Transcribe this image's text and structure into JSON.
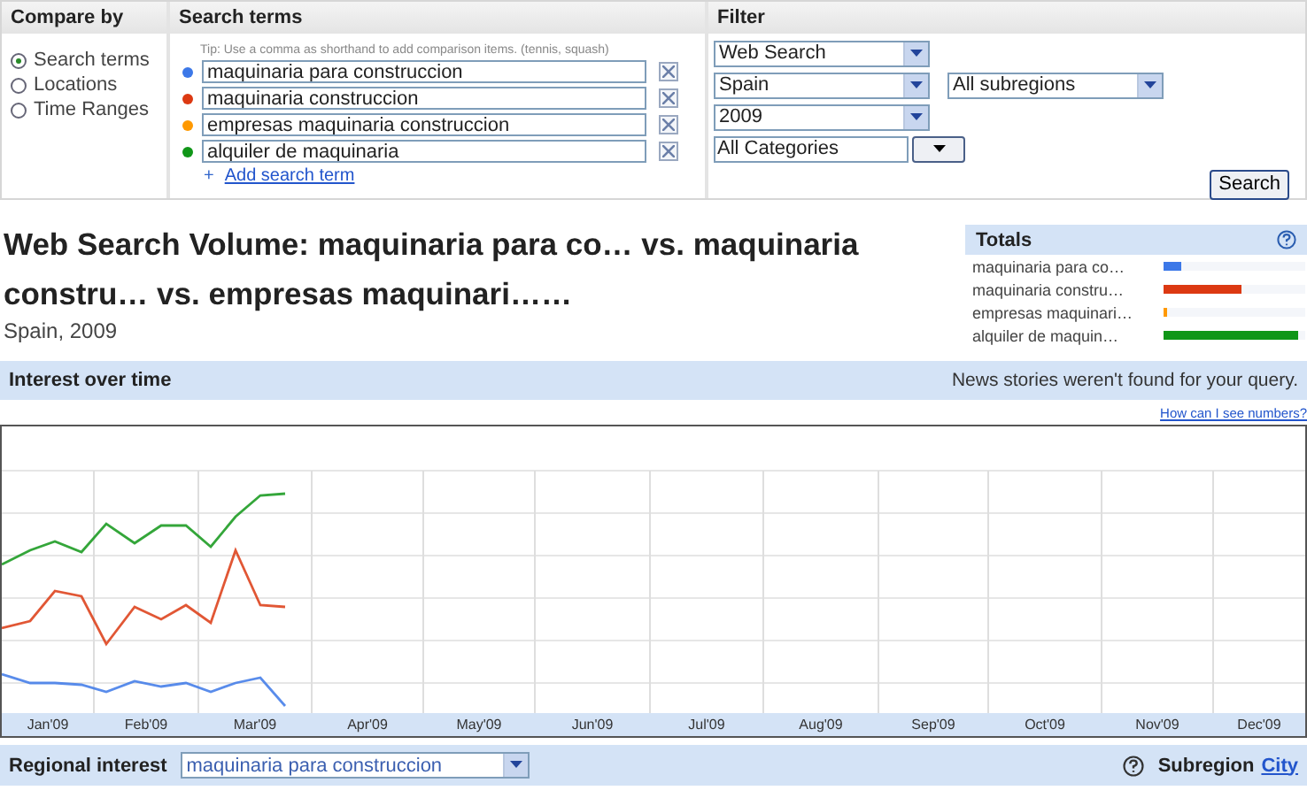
{
  "compare_by": {
    "title": "Compare by",
    "options": [
      {
        "label": "Search terms",
        "selected": true
      },
      {
        "label": "Locations",
        "selected": false
      },
      {
        "label": "Time Ranges",
        "selected": false
      }
    ]
  },
  "search_terms": {
    "title": "Search terms",
    "tip": "Tip: Use a comma as shorthand to add comparison items. (tennis, squash)",
    "terms": [
      {
        "value": "maquinaria para construccion",
        "color": "#3c78e8"
      },
      {
        "value": "maquinaria construccion",
        "color": "#dc3912"
      },
      {
        "value": "empresas maquinaria construccion",
        "color": "#ff9900"
      },
      {
        "value": "alquiler de maquinaria",
        "color": "#109618"
      }
    ],
    "add_icon": "+",
    "add_link": "Add search term"
  },
  "filter": {
    "title": "Filter",
    "property": "Web Search",
    "location": "Spain",
    "subregion": "All subregions",
    "time": "2009",
    "category": "All Categories",
    "search_button": "Search"
  },
  "heading": {
    "title": "Web Search Volume: maquinaria para co… vs. maquinaria constru… vs. empresas maquinari……",
    "subtitle": "Spain, 2009"
  },
  "totals": {
    "title": "Totals",
    "items": [
      {
        "label": "maquinaria para co…",
        "color": "#3c78e8",
        "level": 0.12
      },
      {
        "label": "maquinaria constru…",
        "color": "#dc3912",
        "level": 0.55
      },
      {
        "label": "empresas maquinari…",
        "color": "#ff9900",
        "level": 0.02
      },
      {
        "label": "alquiler de maquin…",
        "color": "#109618",
        "level": 0.95
      }
    ]
  },
  "interest_over_time": {
    "title": "Interest over time",
    "notice": "News stories weren't found for your query.",
    "help_link": "How can I see numbers?",
    "months": [
      "Jan'09",
      "Feb'09",
      "Mar'09",
      "Apr'09",
      "May'09",
      "Jun'09",
      "Jul'09",
      "Aug'09",
      "Sep'09",
      "Oct'09",
      "Nov'09",
      "Dec'09"
    ]
  },
  "regional_interest": {
    "title": "Regional interest",
    "term": "maquinaria para construccion",
    "subregion_label": "Subregion",
    "city_link": "City"
  }
}
